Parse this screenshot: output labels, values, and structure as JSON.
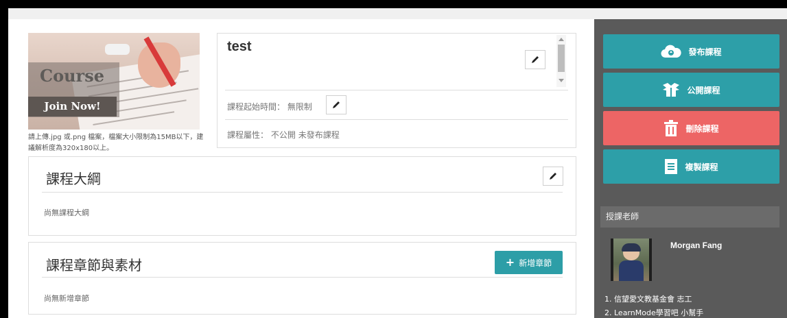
{
  "cover": {
    "title": "Course",
    "subtitle": "Join Now!",
    "note": "請上傳.jpg 或.png 檔案，檔案大小限制為15MB以下，建議解析度為320x180以上。"
  },
  "course": {
    "title": "test",
    "start_time_label": "課程起始時間：",
    "start_time_value": "無限制",
    "attribute_label": "課程屬性：",
    "visibility": "不公開",
    "publish_status": "未發布課程"
  },
  "outline": {
    "title": "課程大綱",
    "empty_text": "尚無課程大綱"
  },
  "chapters": {
    "title": "課程章節與素材",
    "add_button": "新增章節",
    "empty_text": "尚無新增章節"
  },
  "actions": {
    "publish": "發布課程",
    "open": "公開課程",
    "delete": "刪除課程",
    "copy": "複製課程"
  },
  "teacher": {
    "header": "授課老師",
    "name": "Morgan Fang",
    "roles": [
      "1. 信望愛文教基金會 志工",
      "2. LearnMode學習吧 小幫手"
    ]
  },
  "colors": {
    "teal": "#2d9fa8",
    "red": "#ed6565",
    "panel": "#5a5a5a"
  },
  "icons": [
    "pencil-icon",
    "cloud-upload-icon",
    "open-box-icon",
    "trash-icon",
    "document-icon",
    "plus-icon"
  ]
}
